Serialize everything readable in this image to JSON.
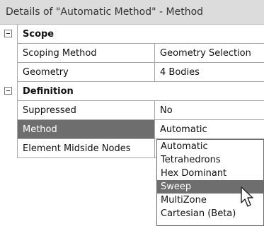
{
  "panel": {
    "title": "Details of \"Automatic Method\" - Method"
  },
  "groups": {
    "scope": "Scope",
    "definition": "Definition"
  },
  "rows": {
    "scoping_method": {
      "name": "Scoping Method",
      "value": "Geometry Selection"
    },
    "geometry": {
      "name": "Geometry",
      "value": "4 Bodies"
    },
    "suppressed": {
      "name": "Suppressed",
      "value": "No"
    },
    "method": {
      "name": "Method",
      "value": "Automatic"
    },
    "element_midside_nodes": {
      "name": "Element Midside Nodes",
      "value": ""
    }
  },
  "dropdown": {
    "options": [
      "Automatic",
      "Tetrahedrons",
      "Hex Dominant",
      "Sweep",
      "MultiZone",
      "Cartesian (Beta)"
    ],
    "highlighted": "Sweep"
  },
  "colors": {
    "selection": "#6e6e6e",
    "titlebar": "#dcdcdc",
    "gridline": "#a8a8a8"
  },
  "icons": {
    "expander": "minus-box-icon",
    "cursor": "arrow-pointer-icon"
  }
}
